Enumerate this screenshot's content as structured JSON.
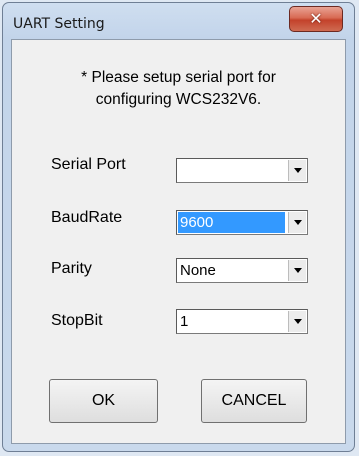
{
  "window": {
    "title": "UART Setting"
  },
  "titlebar": {
    "close_icon": "close-icon"
  },
  "notice": {
    "line1": "* Please setup serial port for",
    "line2": "configuring WCS232V6."
  },
  "fields": {
    "serial_port": {
      "label": "Serial Port",
      "value": ""
    },
    "baud_rate": {
      "label": "BaudRate",
      "value": "9600"
    },
    "parity": {
      "label": "Parity",
      "value": "None"
    },
    "stop_bit": {
      "label": "StopBit",
      "value": "1"
    }
  },
  "buttons": {
    "ok": "OK",
    "cancel": "CANCEL"
  },
  "colors": {
    "selection": "#3399ff",
    "close_button": "#c3422b"
  }
}
